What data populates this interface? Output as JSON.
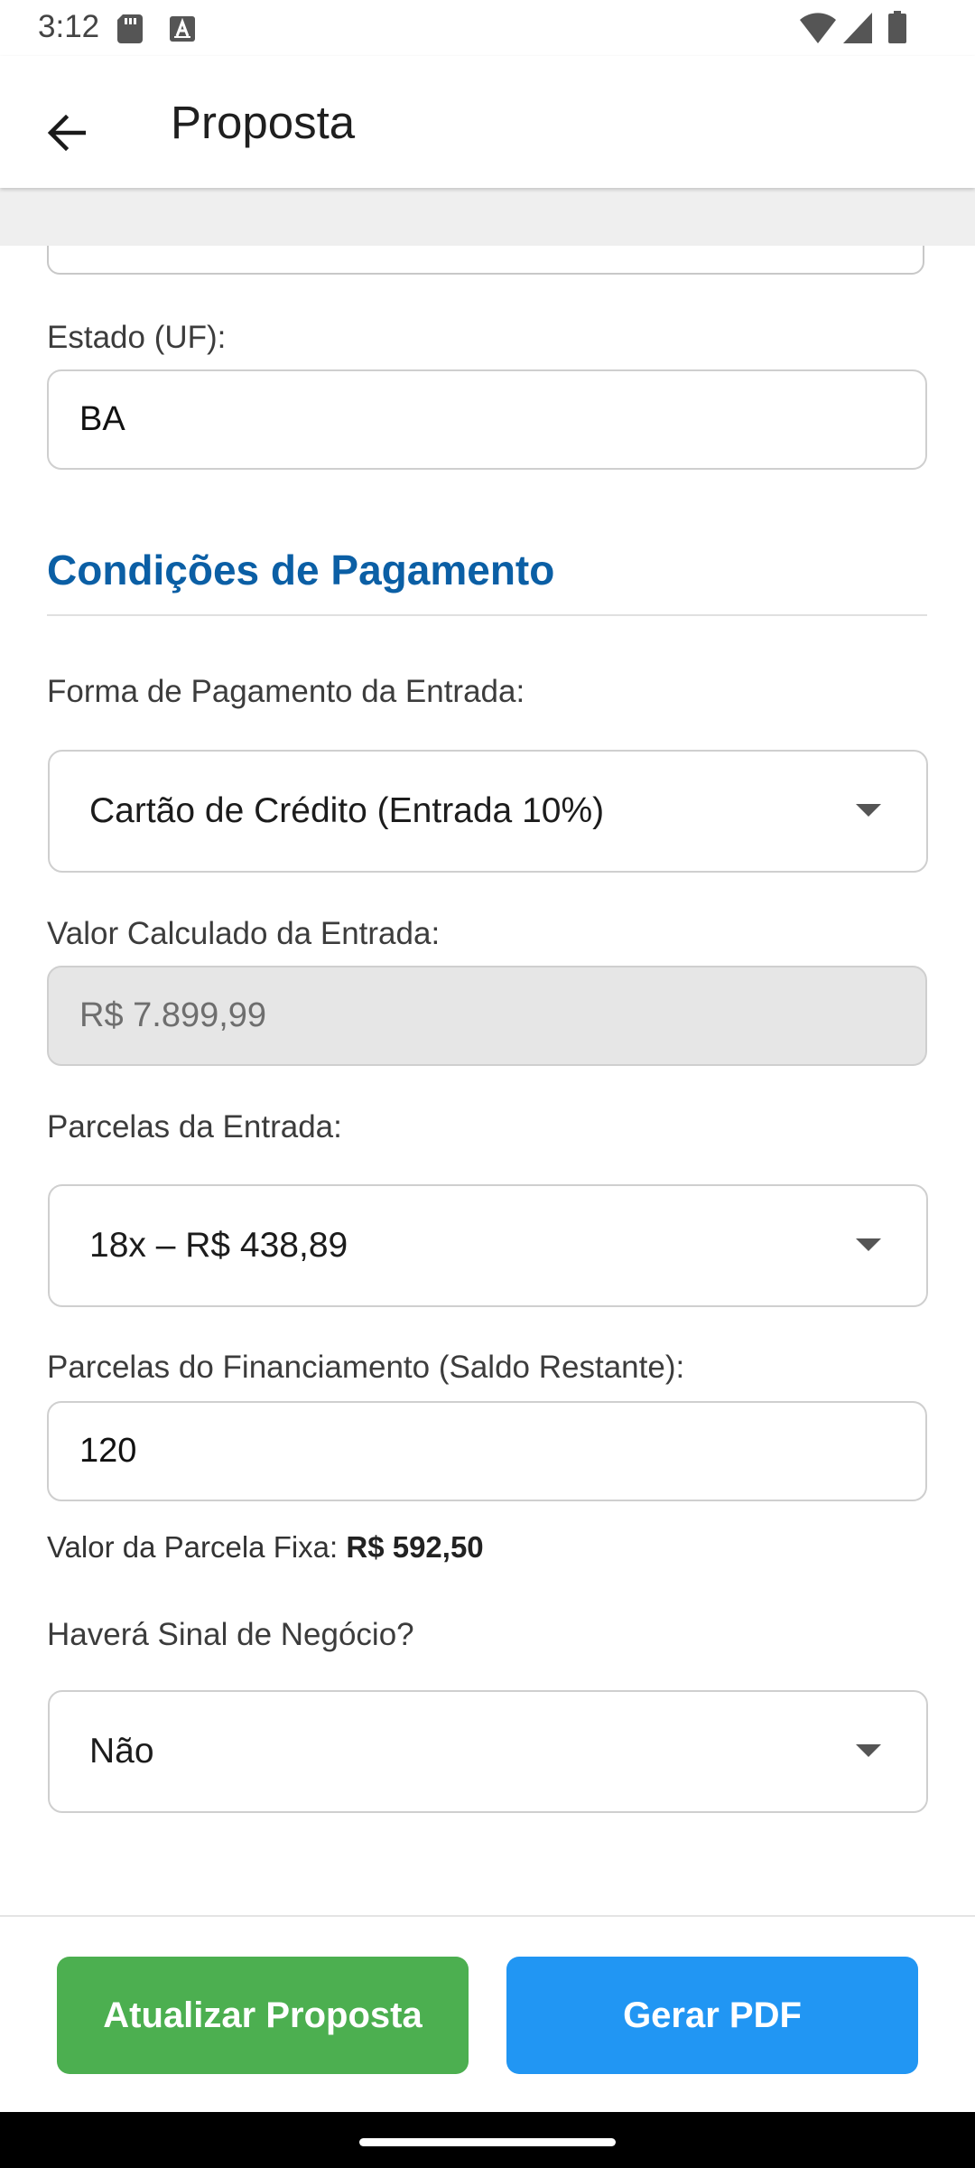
{
  "status_bar": {
    "time": "3:12"
  },
  "app_bar": {
    "title": "Proposta",
    "back_icon": "arrow-left-icon"
  },
  "form": {
    "state": {
      "label": "Estado (UF):",
      "value": "BA"
    },
    "payment_section": {
      "title": "Condições de Pagamento"
    },
    "down_payment_method": {
      "label": "Forma de Pagamento da Entrada:",
      "selected": "Cartão de Crédito (Entrada 10%)"
    },
    "down_payment_value": {
      "label": "Valor Calculado da Entrada:",
      "value": "R$ 7.899,99"
    },
    "down_payment_installments": {
      "label": "Parcelas da Entrada:",
      "selected": "18x – R$ 438,89"
    },
    "financing_installments": {
      "label": "Parcelas do Financiamento (Saldo Restante):",
      "value": "120"
    },
    "fixed_installment": {
      "label": "Valor da Parcela Fixa: ",
      "value": "R$ 592,50"
    },
    "deal_signal": {
      "label": "Haverá Sinal de Negócio?",
      "selected": "Não"
    }
  },
  "actions": {
    "update_label": "Atualizar Proposta",
    "pdf_label": "Gerar PDF"
  },
  "colors": {
    "section_title": "#0b5fa5",
    "update_button": "#4caf50",
    "pdf_button": "#2196f3"
  }
}
